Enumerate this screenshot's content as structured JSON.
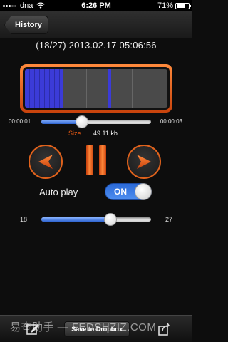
{
  "status_bar": {
    "carrier": "dna",
    "time": "6:26 PM",
    "battery_percent": "71%",
    "battery_level": 0.71
  },
  "nav": {
    "back_label": "History"
  },
  "recording": {
    "title": "(18/27) 2013.02.17 05:06:56"
  },
  "waveform": {
    "played_fraction": 0.27,
    "colors": {
      "frame": "#e0621c",
      "played": "#3b3bd8"
    }
  },
  "seek": {
    "elapsed": "00:00:01",
    "total": "00:00:03",
    "position": 0.37
  },
  "size": {
    "label": "Size",
    "value": "49.11  kb"
  },
  "controls": {
    "prev_icon": "left-arrow-icon",
    "pause_icon": "pause-icon",
    "next_icon": "right-arrow-icon"
  },
  "autoplay": {
    "label": "Auto play",
    "state": "ON",
    "on": true
  },
  "volume_slider": {
    "min_label": "18",
    "max_label": "27",
    "position": 0.63
  },
  "toolbar": {
    "edit_icon": "edit-icon",
    "dropbox_label": "Save to Dropbox",
    "share_icon": "share-icon"
  },
  "watermark": "易查助手 — FEDSHZIZ.COM"
}
